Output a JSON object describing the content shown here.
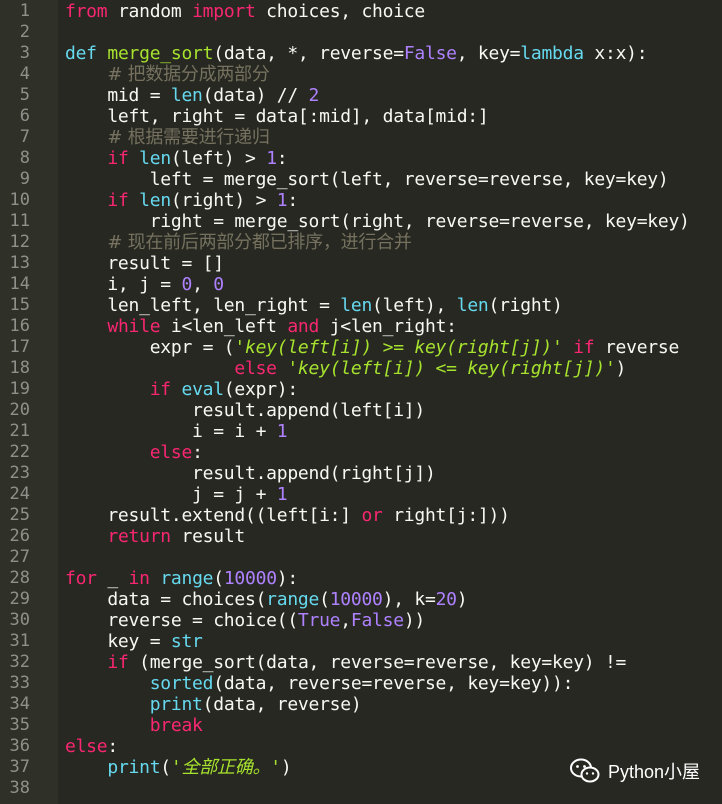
{
  "line_numbers": [
    "1",
    "2",
    "3",
    "4",
    "5",
    "6",
    "7",
    "8",
    "9",
    "10",
    "11",
    "12",
    "13",
    "14",
    "15",
    "16",
    "17",
    "18",
    "19",
    "20",
    "21",
    "22",
    "23",
    "24",
    "25",
    "26",
    "27",
    "28",
    "29",
    "30",
    "31",
    "32",
    "33",
    "34",
    "35",
    "36",
    "37",
    "38"
  ],
  "code_lines": [
    [
      {
        "t": "from",
        "c": "k"
      },
      {
        "t": " random "
      },
      {
        "t": "import",
        "c": "k"
      },
      {
        "t": " choices, choice"
      }
    ],
    [],
    [
      {
        "t": "def",
        "c": "b"
      },
      {
        "t": " "
      },
      {
        "t": "merge_sort",
        "c": "f"
      },
      {
        "t": "(data, *, reverse="
      },
      {
        "t": "False",
        "c": "n"
      },
      {
        "t": ", key="
      },
      {
        "t": "lambda",
        "c": "b"
      },
      {
        "t": " x:x):"
      }
    ],
    [
      {
        "t": "    "
      },
      {
        "t": "# 把数据分成两部分",
        "c": "c"
      }
    ],
    [
      {
        "t": "    mid = "
      },
      {
        "t": "len",
        "c": "b"
      },
      {
        "t": "(data) // "
      },
      {
        "t": "2",
        "c": "n"
      }
    ],
    [
      {
        "t": "    left, right = data[:mid], data[mid:]"
      }
    ],
    [
      {
        "t": "    "
      },
      {
        "t": "# 根据需要进行递归",
        "c": "c"
      }
    ],
    [
      {
        "t": "    "
      },
      {
        "t": "if",
        "c": "k"
      },
      {
        "t": " "
      },
      {
        "t": "len",
        "c": "b"
      },
      {
        "t": "(left) > "
      },
      {
        "t": "1",
        "c": "n"
      },
      {
        "t": ":"
      }
    ],
    [
      {
        "t": "        left = merge_sort(left, reverse=reverse, key=key)"
      }
    ],
    [
      {
        "t": "    "
      },
      {
        "t": "if",
        "c": "k"
      },
      {
        "t": " "
      },
      {
        "t": "len",
        "c": "b"
      },
      {
        "t": "(right) > "
      },
      {
        "t": "1",
        "c": "n"
      },
      {
        "t": ":"
      }
    ],
    [
      {
        "t": "        right = merge_sort(right, reverse=reverse, key=key)"
      }
    ],
    [
      {
        "t": "    "
      },
      {
        "t": "# 现在前后两部分都已排序，进行合并",
        "c": "c"
      }
    ],
    [
      {
        "t": "    result = []"
      }
    ],
    [
      {
        "t": "    i, j = "
      },
      {
        "t": "0",
        "c": "n"
      },
      {
        "t": ", "
      },
      {
        "t": "0",
        "c": "n"
      }
    ],
    [
      {
        "t": "    len_left, len_right = "
      },
      {
        "t": "len",
        "c": "b"
      },
      {
        "t": "(left), "
      },
      {
        "t": "len",
        "c": "b"
      },
      {
        "t": "(right)"
      }
    ],
    [
      {
        "t": "    "
      },
      {
        "t": "while",
        "c": "k"
      },
      {
        "t": " i<len_left "
      },
      {
        "t": "and",
        "c": "k"
      },
      {
        "t": " j<len_right:"
      }
    ],
    [
      {
        "t": "        expr = ("
      },
      {
        "t": "'key(left[i]) >= key(right[j])'",
        "c": "si"
      },
      {
        "t": " "
      },
      {
        "t": "if",
        "c": "k"
      },
      {
        "t": " reverse"
      }
    ],
    [
      {
        "t": "                "
      },
      {
        "t": "else",
        "c": "k"
      },
      {
        "t": " "
      },
      {
        "t": "'key(left[i]) <= key(right[j])'",
        "c": "si"
      },
      {
        "t": ")"
      }
    ],
    [
      {
        "t": "        "
      },
      {
        "t": "if",
        "c": "k"
      },
      {
        "t": " "
      },
      {
        "t": "eval",
        "c": "b"
      },
      {
        "t": "(expr):"
      }
    ],
    [
      {
        "t": "            result.append(left[i])"
      }
    ],
    [
      {
        "t": "            i = i + "
      },
      {
        "t": "1",
        "c": "n"
      }
    ],
    [
      {
        "t": "        "
      },
      {
        "t": "else",
        "c": "k"
      },
      {
        "t": ":"
      }
    ],
    [
      {
        "t": "            result.append(right[j])"
      }
    ],
    [
      {
        "t": "            j = j + "
      },
      {
        "t": "1",
        "c": "n"
      }
    ],
    [
      {
        "t": "    result.extend((left[i:] "
      },
      {
        "t": "or",
        "c": "k"
      },
      {
        "t": " right[j:]))"
      }
    ],
    [
      {
        "t": "    "
      },
      {
        "t": "return",
        "c": "k"
      },
      {
        "t": " result"
      }
    ],
    [],
    [
      {
        "t": "for",
        "c": "k"
      },
      {
        "t": " _ "
      },
      {
        "t": "in",
        "c": "k"
      },
      {
        "t": " "
      },
      {
        "t": "range",
        "c": "b"
      },
      {
        "t": "("
      },
      {
        "t": "10000",
        "c": "n"
      },
      {
        "t": "):"
      }
    ],
    [
      {
        "t": "    data = choices("
      },
      {
        "t": "range",
        "c": "b"
      },
      {
        "t": "("
      },
      {
        "t": "10000",
        "c": "n"
      },
      {
        "t": "), k="
      },
      {
        "t": "20",
        "c": "n"
      },
      {
        "t": ")"
      }
    ],
    [
      {
        "t": "    reverse = choice(("
      },
      {
        "t": "True",
        "c": "n"
      },
      {
        "t": ","
      },
      {
        "t": "False",
        "c": "n"
      },
      {
        "t": "))"
      }
    ],
    [
      {
        "t": "    key = "
      },
      {
        "t": "str",
        "c": "b"
      }
    ],
    [
      {
        "t": "    "
      },
      {
        "t": "if",
        "c": "k"
      },
      {
        "t": " (merge_sort(data, reverse=reverse, key=key) !="
      }
    ],
    [
      {
        "t": "        "
      },
      {
        "t": "sorted",
        "c": "b"
      },
      {
        "t": "(data, reverse=reverse, key=key)):"
      }
    ],
    [
      {
        "t": "        "
      },
      {
        "t": "print",
        "c": "b"
      },
      {
        "t": "(data, reverse)"
      }
    ],
    [
      {
        "t": "        "
      },
      {
        "t": "break",
        "c": "k"
      }
    ],
    [
      {
        "t": "else",
        "c": "k"
      },
      {
        "t": ":"
      }
    ],
    [
      {
        "t": "    "
      },
      {
        "t": "print",
        "c": "b"
      },
      {
        "t": "("
      },
      {
        "t": "'全部正确。'",
        "c": "si"
      },
      {
        "t": ")"
      }
    ],
    []
  ],
  "watermark": {
    "text": "Python小屋",
    "icon": "wechat-icon"
  }
}
